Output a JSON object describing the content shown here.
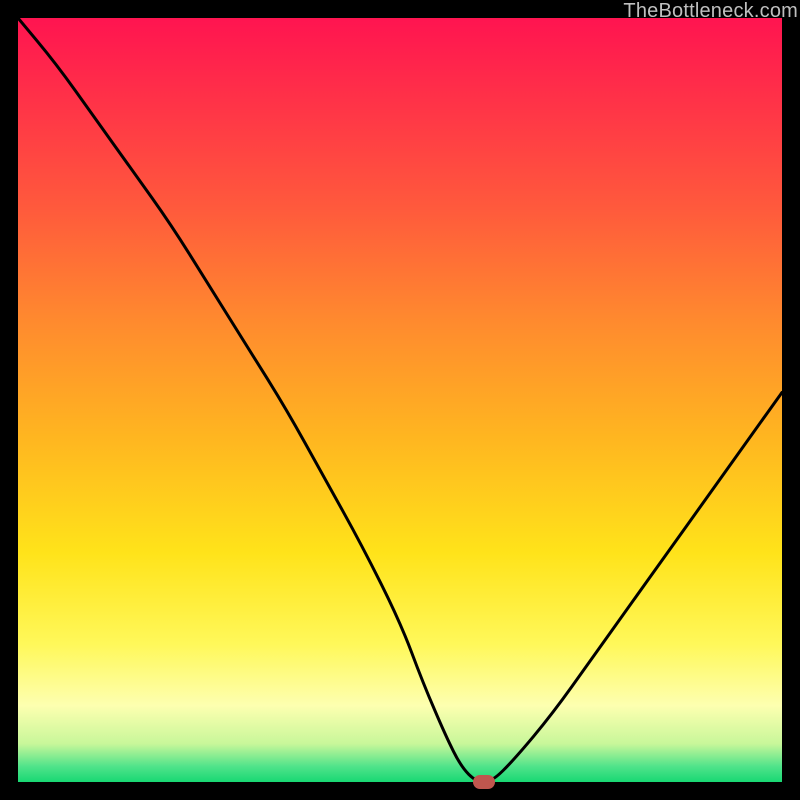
{
  "watermark": {
    "text": "TheBottleneck.com"
  },
  "colors": {
    "curve_stroke": "#000000",
    "marker_fill": "#c0564e",
    "page_bg": "#000000"
  },
  "chart_data": {
    "type": "line",
    "title": "",
    "xlabel": "",
    "ylabel": "",
    "xlim": [
      0,
      100
    ],
    "ylim": [
      0,
      100
    ],
    "grid": false,
    "legend": false,
    "series": [
      {
        "name": "bottleneck-curve",
        "x": [
          0,
          5,
          10,
          15,
          20,
          25,
          30,
          35,
          40,
          45,
          50,
          53,
          56,
          58,
          60,
          62,
          65,
          70,
          75,
          80,
          85,
          90,
          95,
          100
        ],
        "y": [
          100,
          94,
          87,
          80,
          73,
          65,
          57,
          49,
          40,
          31,
          21,
          13,
          6,
          2,
          0,
          0,
          3,
          9,
          16,
          23,
          30,
          37,
          44,
          51
        ]
      }
    ],
    "marker": {
      "x": 61,
      "y": 0,
      "series": "bottleneck-curve"
    }
  }
}
